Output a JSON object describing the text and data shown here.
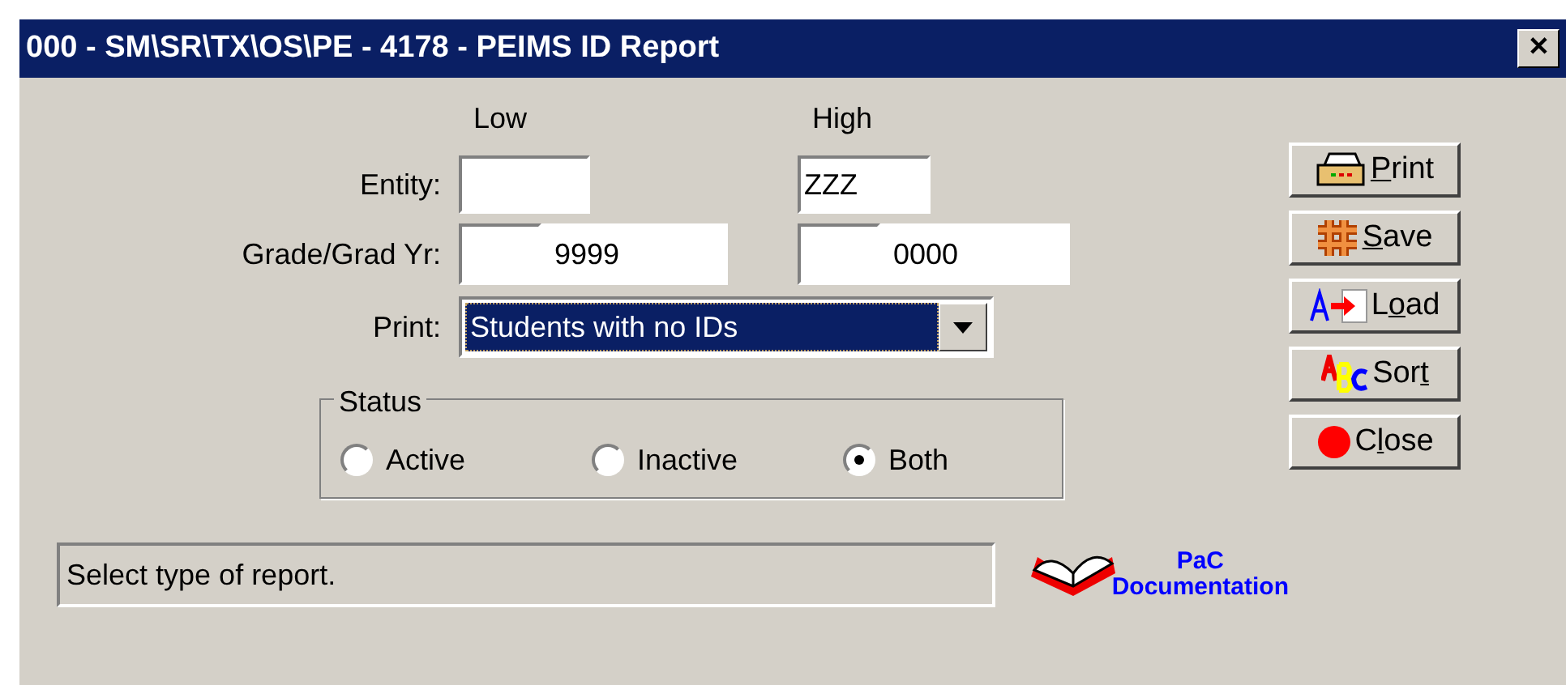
{
  "window": {
    "title": "000 - SM\\SR\\TX\\OS\\PE - 4178 - PEIMS ID Report",
    "close": "✕"
  },
  "columns": {
    "low": "Low",
    "high": "High"
  },
  "entity": {
    "label": "Entity:",
    "high": "ZZZ"
  },
  "grade": {
    "label": "Grade/Grad Yr:",
    "low_year": "9999",
    "high_year": "0000"
  },
  "print": {
    "label": "Print:",
    "value": "Students with no IDs"
  },
  "status": {
    "title": "Status",
    "options": [
      {
        "label": "Active",
        "selected": false
      },
      {
        "label": "Inactive",
        "selected": false
      },
      {
        "label": "Both",
        "selected": true
      }
    ]
  },
  "message": "Select type of report.",
  "documentation": {
    "line1": "PaC",
    "line2": "Documentation"
  },
  "buttons": [
    {
      "kind": "print",
      "key": "P",
      "after": "rint"
    },
    {
      "kind": "save",
      "key": "S",
      "after": "ave"
    },
    {
      "kind": "load",
      "before": "L",
      "key": "o",
      "after": "ad"
    },
    {
      "kind": "sort",
      "before": "Sor",
      "key": "t"
    },
    {
      "kind": "close",
      "before": "C",
      "key": "l",
      "after": "ose"
    }
  ]
}
